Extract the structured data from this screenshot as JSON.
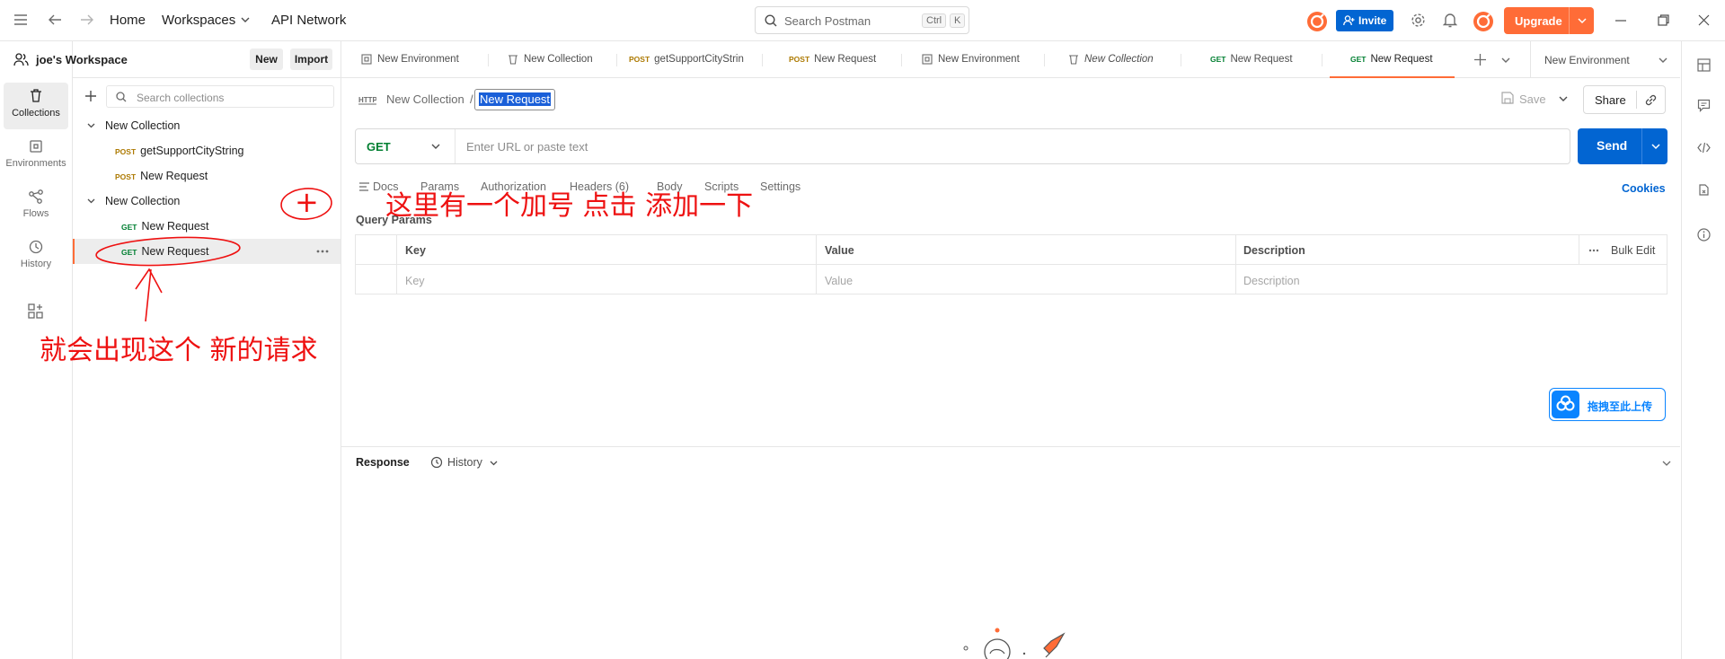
{
  "titlebar": {
    "home": "Home",
    "workspaces": "Workspaces",
    "api_network": "API Network",
    "search_placeholder": "Search Postman",
    "kbd_ctrl": "Ctrl",
    "kbd_k": "K",
    "invite": "Invite",
    "upgrade": "Upgrade"
  },
  "rail": {
    "items": [
      "Collections",
      "Environments",
      "Flows",
      "History"
    ]
  },
  "sidebar": {
    "workspace_name": "joe's Workspace",
    "new_btn": "New",
    "import_btn": "Import",
    "search_placeholder": "Search collections",
    "tree": [
      {
        "label": "New Collection"
      },
      {
        "method": "POST",
        "label": "getSupportCityString"
      },
      {
        "method": "POST",
        "label": "New Request"
      },
      {
        "label": "New Collection"
      },
      {
        "method": "GET",
        "label": "New Request"
      },
      {
        "method": "GET",
        "label": "New Request"
      }
    ]
  },
  "tabs": [
    {
      "label": "New Environment"
    },
    {
      "label": "New Collection"
    },
    {
      "method": "POST",
      "label": "getSupportCityStrin"
    },
    {
      "method": "POST",
      "label": "New Request"
    },
    {
      "label": "New Environment"
    },
    {
      "label": "New Collection"
    },
    {
      "method": "GET",
      "label": "New Request"
    },
    {
      "method": "GET",
      "label": "New Request"
    }
  ],
  "env_selector": "New Environment",
  "request": {
    "breadcrumb_parent": "New Collection",
    "breadcrumb_sep": "/",
    "name": "New Request",
    "save": "Save",
    "share": "Share",
    "method": "GET",
    "url_placeholder": "Enter URL or paste text",
    "send": "Send",
    "tabs": [
      "Docs",
      "Params",
      "Authorization",
      "Headers (6)",
      "Body",
      "Scripts",
      "Settings"
    ],
    "cookies": "Cookies",
    "query_params": "Query Params",
    "col_key": "Key",
    "col_value": "Value",
    "col_desc": "Description",
    "bulk_edit": "Bulk Edit",
    "ph_key": "Key",
    "ph_value": "Value",
    "ph_desc": "Description"
  },
  "upload_btn": "拖拽至此上传",
  "response": {
    "label": "Response",
    "history": "History"
  },
  "annotations": {
    "top_note": "这里有一个加号 点击 添加一下",
    "bottom_note": "就会出现这个 新的请求",
    "plus": "+"
  },
  "colors": {
    "accent": "#ff6c37",
    "brand_blue": "#0265d2",
    "post": "#ad7a03",
    "get": "#007f31",
    "annotation": "#ee1111"
  }
}
